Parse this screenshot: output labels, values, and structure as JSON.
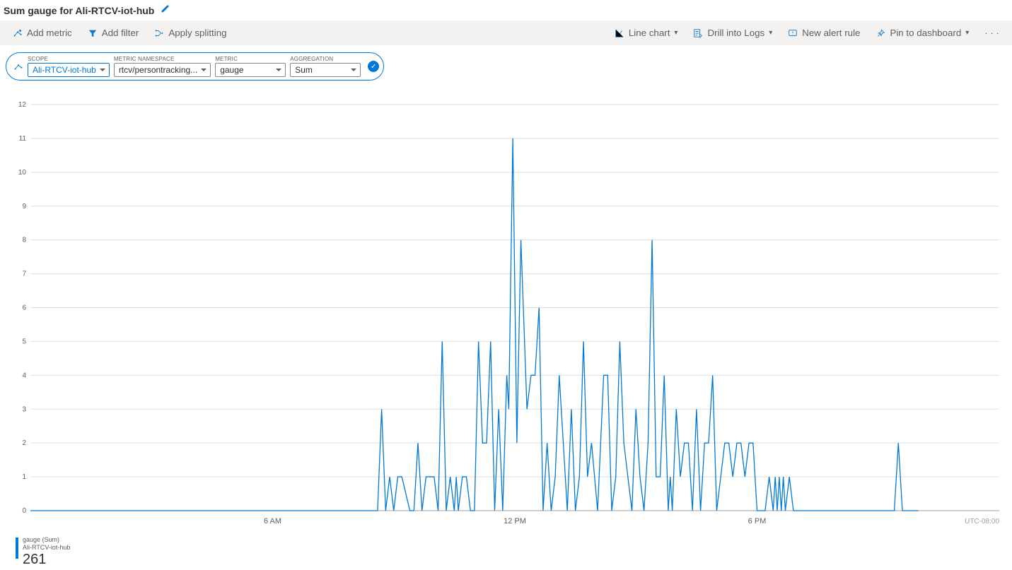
{
  "title": "Sum gauge for Ali-RTCV-iot-hub",
  "toolbar": {
    "left": [
      {
        "id": "add-metric",
        "label": "Add metric"
      },
      {
        "id": "add-filter",
        "label": "Add filter"
      },
      {
        "id": "apply-splitting",
        "label": "Apply splitting"
      }
    ],
    "right": [
      {
        "id": "chart-type",
        "label": "Line chart"
      },
      {
        "id": "drill-logs",
        "label": "Drill into Logs"
      },
      {
        "id": "new-alert-rule",
        "label": "New alert rule"
      },
      {
        "id": "pin-dashboard",
        "label": "Pin to dashboard"
      }
    ]
  },
  "pill": {
    "scope_label": "SCOPE",
    "scope_value": "Ali-RTCV-iot-hub",
    "ns_label": "METRIC NAMESPACE",
    "ns_value": "rtcv/persontracking...",
    "metric_label": "METRIC",
    "metric_value": "gauge",
    "agg_label": "AGGREGATION",
    "agg_value": "Sum"
  },
  "legend": {
    "series": "gauge (Sum)",
    "resource": "Ali-RTCV-iot-hub",
    "value": "261"
  },
  "timezone": "UTC-08:00",
  "chart_data": {
    "type": "line",
    "title": "Sum gauge for Ali-RTCV-iot-hub",
    "xlabel": "",
    "ylabel": "",
    "ylim": [
      0,
      12
    ],
    "yticks": [
      0,
      1,
      2,
      3,
      4,
      5,
      6,
      7,
      8,
      9,
      10,
      11,
      12
    ],
    "x_range_hours": [
      0,
      24
    ],
    "xticks": [
      {
        "h": 6,
        "label": "6 AM"
      },
      {
        "h": 12,
        "label": "12 PM"
      },
      {
        "h": 18,
        "label": "6 PM"
      }
    ],
    "series": [
      {
        "name": "gauge (Sum)",
        "points": [
          [
            0.0,
            0
          ],
          [
            8.6,
            0
          ],
          [
            8.7,
            3
          ],
          [
            8.8,
            0
          ],
          [
            8.9,
            1
          ],
          [
            9.0,
            0
          ],
          [
            9.1,
            1
          ],
          [
            9.2,
            1
          ],
          [
            9.4,
            0
          ],
          [
            9.5,
            0
          ],
          [
            9.6,
            2
          ],
          [
            9.7,
            0
          ],
          [
            9.8,
            1
          ],
          [
            9.9,
            1
          ],
          [
            10.0,
            1
          ],
          [
            10.1,
            0
          ],
          [
            10.2,
            5
          ],
          [
            10.3,
            0
          ],
          [
            10.4,
            1
          ],
          [
            10.5,
            0
          ],
          [
            10.55,
            1
          ],
          [
            10.6,
            0
          ],
          [
            10.7,
            1
          ],
          [
            10.8,
            1
          ],
          [
            10.9,
            0
          ],
          [
            11.0,
            0
          ],
          [
            11.1,
            5
          ],
          [
            11.2,
            2
          ],
          [
            11.3,
            2
          ],
          [
            11.4,
            5
          ],
          [
            11.5,
            0
          ],
          [
            11.6,
            3
          ],
          [
            11.7,
            0
          ],
          [
            11.8,
            4
          ],
          [
            11.85,
            3
          ],
          [
            11.95,
            11
          ],
          [
            12.05,
            2
          ],
          [
            12.15,
            8
          ],
          [
            12.3,
            3
          ],
          [
            12.4,
            4
          ],
          [
            12.5,
            4
          ],
          [
            12.6,
            6
          ],
          [
            12.7,
            0
          ],
          [
            12.8,
            2
          ],
          [
            12.9,
            0
          ],
          [
            13.0,
            1
          ],
          [
            13.1,
            4
          ],
          [
            13.2,
            2
          ],
          [
            13.3,
            0
          ],
          [
            13.4,
            3
          ],
          [
            13.5,
            0
          ],
          [
            13.6,
            1
          ],
          [
            13.7,
            5
          ],
          [
            13.8,
            1
          ],
          [
            13.9,
            2
          ],
          [
            14.05,
            0
          ],
          [
            14.2,
            4
          ],
          [
            14.3,
            4
          ],
          [
            14.4,
            0
          ],
          [
            14.5,
            1
          ],
          [
            14.6,
            5
          ],
          [
            14.7,
            2
          ],
          [
            14.8,
            1
          ],
          [
            14.9,
            0
          ],
          [
            15.0,
            3
          ],
          [
            15.1,
            1
          ],
          [
            15.2,
            0
          ],
          [
            15.3,
            2
          ],
          [
            15.4,
            8
          ],
          [
            15.5,
            1
          ],
          [
            15.6,
            1
          ],
          [
            15.7,
            4
          ],
          [
            15.8,
            0
          ],
          [
            15.85,
            1
          ],
          [
            15.9,
            0
          ],
          [
            16.0,
            3
          ],
          [
            16.1,
            1
          ],
          [
            16.2,
            2
          ],
          [
            16.3,
            2
          ],
          [
            16.4,
            0
          ],
          [
            16.5,
            3
          ],
          [
            16.6,
            0
          ],
          [
            16.7,
            2
          ],
          [
            16.8,
            2
          ],
          [
            16.9,
            4
          ],
          [
            17.0,
            0
          ],
          [
            17.1,
            1
          ],
          [
            17.2,
            2
          ],
          [
            17.3,
            2
          ],
          [
            17.4,
            1
          ],
          [
            17.5,
            2
          ],
          [
            17.6,
            2
          ],
          [
            17.7,
            1
          ],
          [
            17.8,
            2
          ],
          [
            17.9,
            2
          ],
          [
            18.0,
            0
          ],
          [
            18.2,
            0
          ],
          [
            18.3,
            1
          ],
          [
            18.4,
            0
          ],
          [
            18.45,
            1
          ],
          [
            18.5,
            0
          ],
          [
            18.55,
            1
          ],
          [
            18.6,
            0
          ],
          [
            18.65,
            1
          ],
          [
            18.7,
            0
          ],
          [
            18.8,
            1
          ],
          [
            18.9,
            0
          ],
          [
            21.4,
            0
          ],
          [
            21.5,
            2
          ],
          [
            21.6,
            0
          ],
          [
            22.0,
            0
          ]
        ]
      }
    ]
  }
}
